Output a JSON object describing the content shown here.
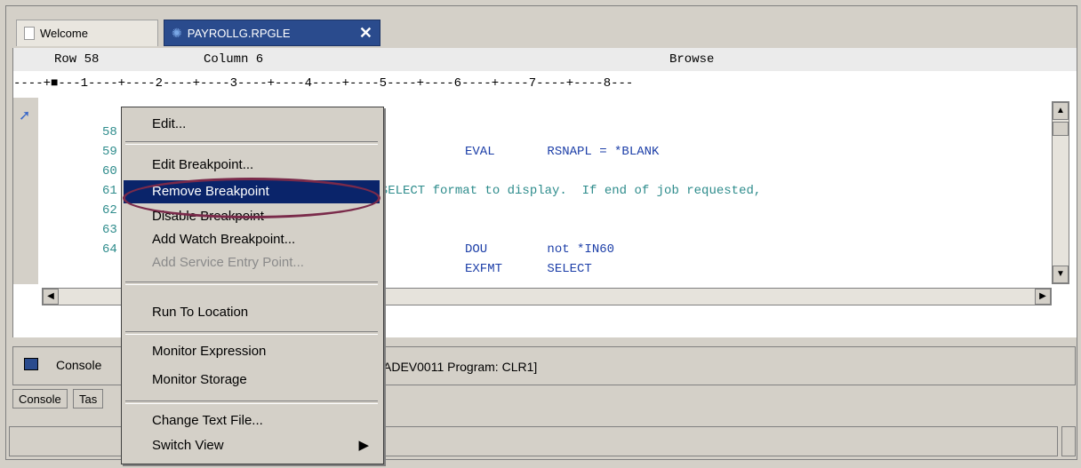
{
  "tabs": [
    {
      "label": "Welcome",
      "icon": "document-icon"
    },
    {
      "label": "PAYROLLG.RPGLE",
      "icon": "gear-icon",
      "close": "✕"
    }
  ],
  "editor": {
    "header": {
      "row": "Row 58",
      "column": "Column 6",
      "mode": "Browse"
    },
    "ruler": "----+■---1----+----2----+----3----+----4----+----5----+----6----+----7----+----8---",
    "lines": [
      {
        "num": "58",
        "text": "EVAL       RSNAPL = *BLANK"
      },
      {
        "num": "59",
        "text": ""
      },
      {
        "num": "60",
        "text": "e SELECT format to display.  If end of job requested,"
      },
      {
        "num": "61",
        "text": ""
      },
      {
        "num": "62",
        "text": ""
      },
      {
        "num": "63",
        "text": "DOU        not *IN60"
      },
      {
        "num": "64",
        "text": "EXFMT      SELECT"
      }
    ]
  },
  "console": {
    "title": "Console",
    "status": "ADEV0011 Program: CLR1]",
    "tabs": [
      "Console",
      "Tas"
    ]
  },
  "context_menu": {
    "items": [
      {
        "label": "Edit...",
        "enabled": true
      },
      {
        "label": "Edit Breakpoint...",
        "enabled": true
      },
      {
        "label": "Remove Breakpoint",
        "enabled": true,
        "selected": true
      },
      {
        "label": "Disable Breakpoint",
        "enabled": true
      },
      {
        "label": "Add Watch Breakpoint...",
        "enabled": true
      },
      {
        "label": "Add Service Entry Point...",
        "enabled": false
      },
      {
        "label": "Run To Location",
        "enabled": true
      },
      {
        "label": "Monitor Expression",
        "enabled": true
      },
      {
        "label": "Monitor Storage",
        "enabled": true
      },
      {
        "label": "Change Text File...",
        "enabled": true
      },
      {
        "label": "Switch View",
        "enabled": true,
        "submenu_arrow": "▶"
      }
    ]
  }
}
